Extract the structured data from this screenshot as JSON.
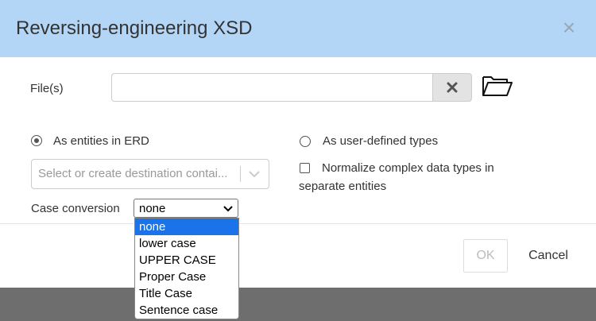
{
  "dialog": {
    "title": "Reversing-engineering XSD",
    "close_glyph": "×"
  },
  "files": {
    "label": "File(s)",
    "value": "",
    "clear_icon": "x-icon",
    "browse_icon": "folder-icon"
  },
  "options": {
    "entities_label": "As entities in ERD",
    "entities_selected": true,
    "udt_label": "As user-defined types",
    "udt_selected": false,
    "container_placeholder": "Select or create destination contai...",
    "normalize_label_line1": "Normalize complex data types in",
    "normalize_label_line2": "separate entities",
    "normalize_checked": false,
    "case_label": "Case conversion",
    "case_value": "none",
    "case_options": [
      "none",
      "lower case",
      "UPPER CASE",
      "Proper Case",
      "Title Case",
      "Sentence case"
    ]
  },
  "footer": {
    "ok_label": "OK",
    "cancel_label": "Cancel"
  },
  "colors": {
    "header_bg": "#b3d6f7",
    "backdrop": "#6e6e6e",
    "selected_option": "#1a73e8"
  }
}
